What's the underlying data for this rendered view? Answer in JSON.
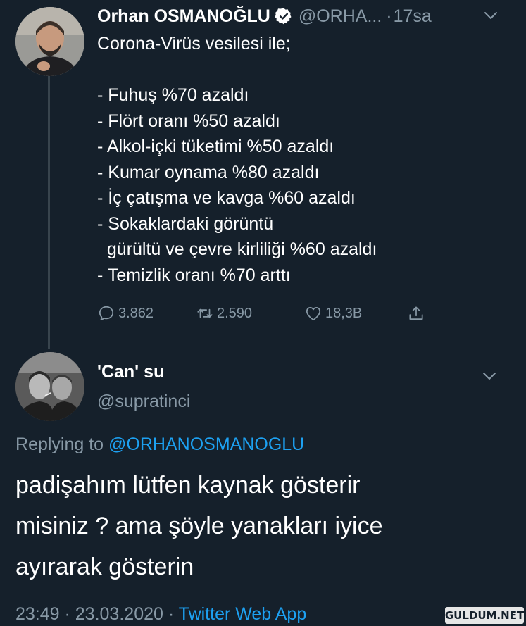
{
  "original_tweet": {
    "author_name": "Orhan OSMANOĞLU",
    "author_handle": "@ORHA...",
    "separator": "·",
    "time": "17sa",
    "lines": [
      "Corona-Virüs vesilesi ile;",
      "",
      "- Fuhuş %70 azaldı",
      "- Flört oranı %50 azaldı",
      "- Alkol-içki tüketimi %50 azaldı",
      "- Kumar oynama %80 azaldı",
      "- İç çatışma ve kavga %60 azaldı",
      "- Sokaklardaki görüntü",
      "  gürültü ve çevre kirliliği %60 azaldı",
      "- Temizlik oranı %70 arttı"
    ],
    "reply_count": "3.862",
    "retweet_count": "2.590",
    "like_count": "18,3B",
    "icons": [
      "verified-badge-icon",
      "chevron-down-icon",
      "reply-icon",
      "retweet-icon",
      "like-icon",
      "share-icon"
    ]
  },
  "reply_tweet": {
    "author_name": "'Can' su",
    "author_handle": "@supratinci",
    "replying_prefix": "Replying to",
    "replying_to": "@ORHANOSMANOGLU",
    "lines": [
      "padişahım lütfen kaynak gösterir",
      "misiniz ? ama şöyle yanakları iyice",
      "ayırarak gösterin"
    ],
    "timestamp": "23:49 · 23.03.2020 ·",
    "source_app": "Twitter Web App"
  },
  "watermark": "GULDUM.NET",
  "colors": {
    "background": "#15202b",
    "text_primary": "#ffffff",
    "text_secondary": "#8899a6",
    "accent": "#1da1f2",
    "thread_line": "#38444d"
  }
}
